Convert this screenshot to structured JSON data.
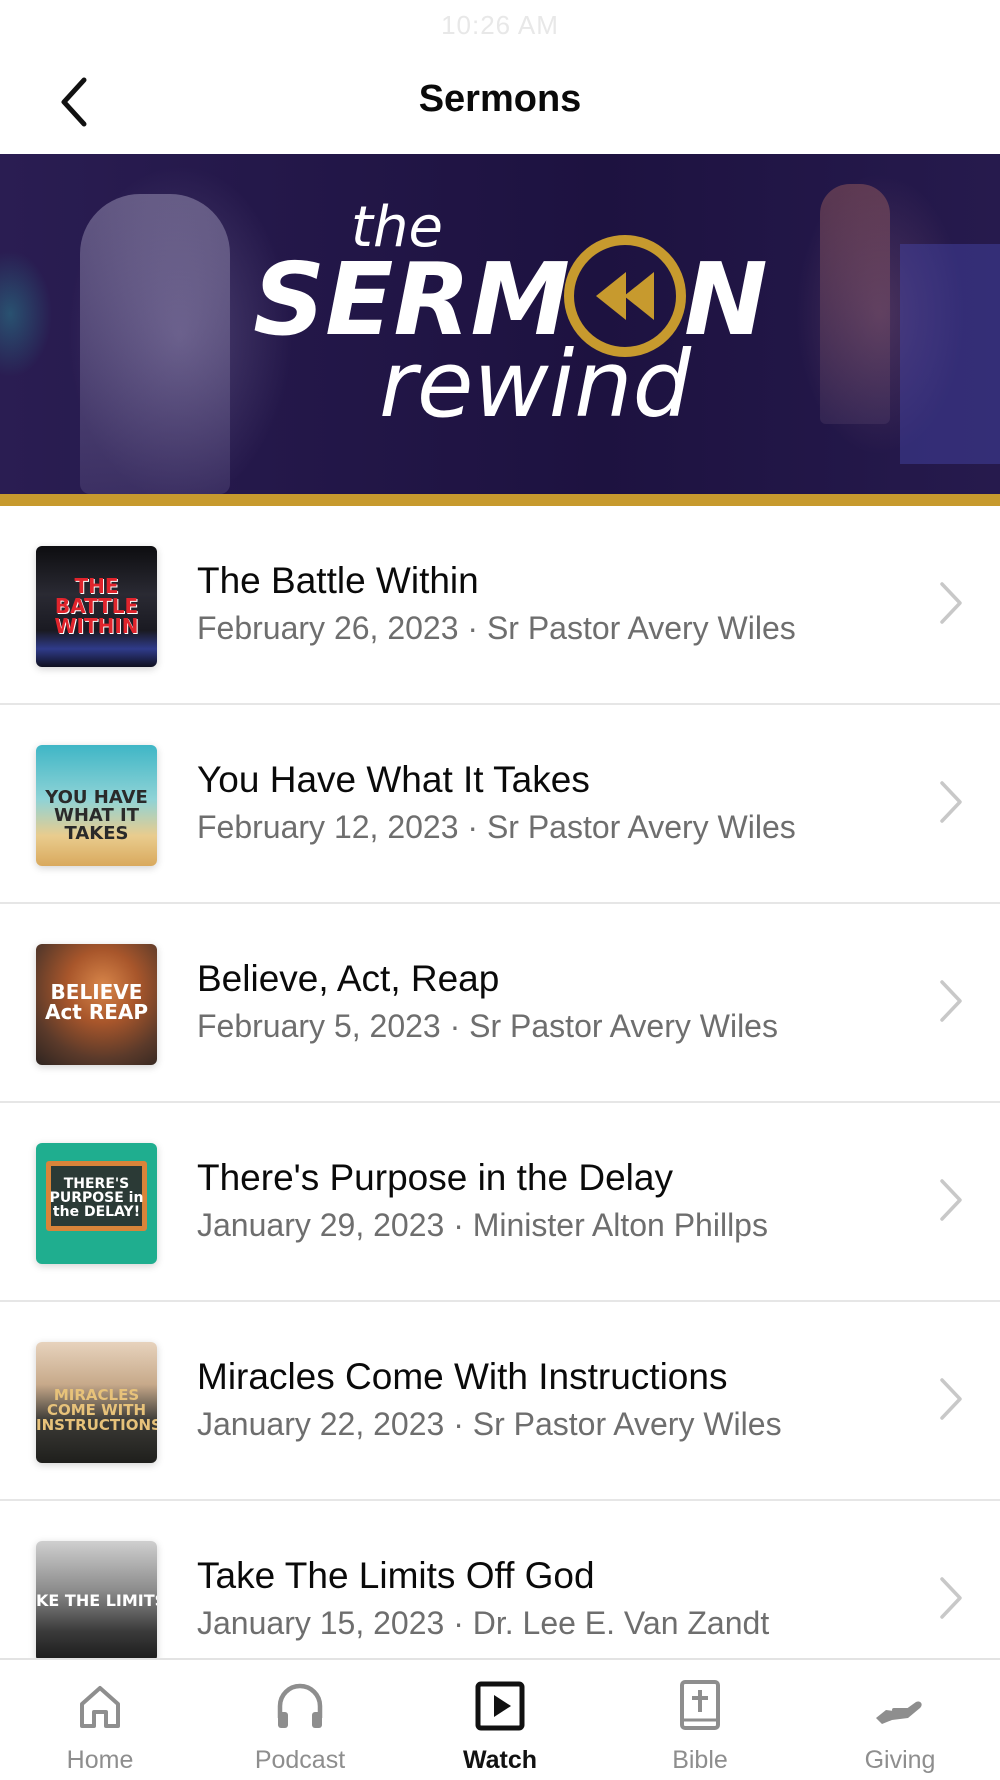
{
  "status_bar": {
    "time": "10:26 AM"
  },
  "nav": {
    "title": "Sermons"
  },
  "banner": {
    "logo_line1": "the",
    "logo_line2_left": "SERM",
    "logo_line2_right": "N",
    "logo_line3": "rewind",
    "accent_color": "#c79a2e",
    "background_color": "#221647"
  },
  "sermons": [
    {
      "title": "The Battle Within",
      "subtitle": "February 26, 2023 · Sr Pastor Avery Wiles",
      "thumb_text": "THE BATTLE WITHIN"
    },
    {
      "title": "You Have What It Takes",
      "subtitle": "February 12, 2023 · Sr Pastor Avery Wiles",
      "thumb_text": "YOU HAVE WHAT IT TAKES"
    },
    {
      "title": "Believe, Act, Reap",
      "subtitle": "February 5, 2023 · Sr Pastor Avery Wiles",
      "thumb_text": "BELIEVE Act REAP"
    },
    {
      "title": "There's Purpose in the Delay",
      "subtitle": "January 29, 2023 · Minister Alton Phillps",
      "thumb_text": "THERE'S PURPOSE in the DELAY!"
    },
    {
      "title": "Miracles Come With Instructions",
      "subtitle": "January 22, 2023 · Sr Pastor Avery Wiles",
      "thumb_text": "MIRACLES COME WITH INSTRUCTIONS"
    },
    {
      "title": "Take The Limits Off God",
      "subtitle": "January 15, 2023 · Dr. Lee E. Van Zandt",
      "thumb_text": "KE THE LIMITS OFF G"
    }
  ],
  "tabs": [
    {
      "label": "Home",
      "icon": "home-icon"
    },
    {
      "label": "Podcast",
      "icon": "headphones-icon"
    },
    {
      "label": "Watch",
      "icon": "play-icon",
      "active": true
    },
    {
      "label": "Bible",
      "icon": "bible-icon"
    },
    {
      "label": "Giving",
      "icon": "giving-hand-icon"
    }
  ]
}
